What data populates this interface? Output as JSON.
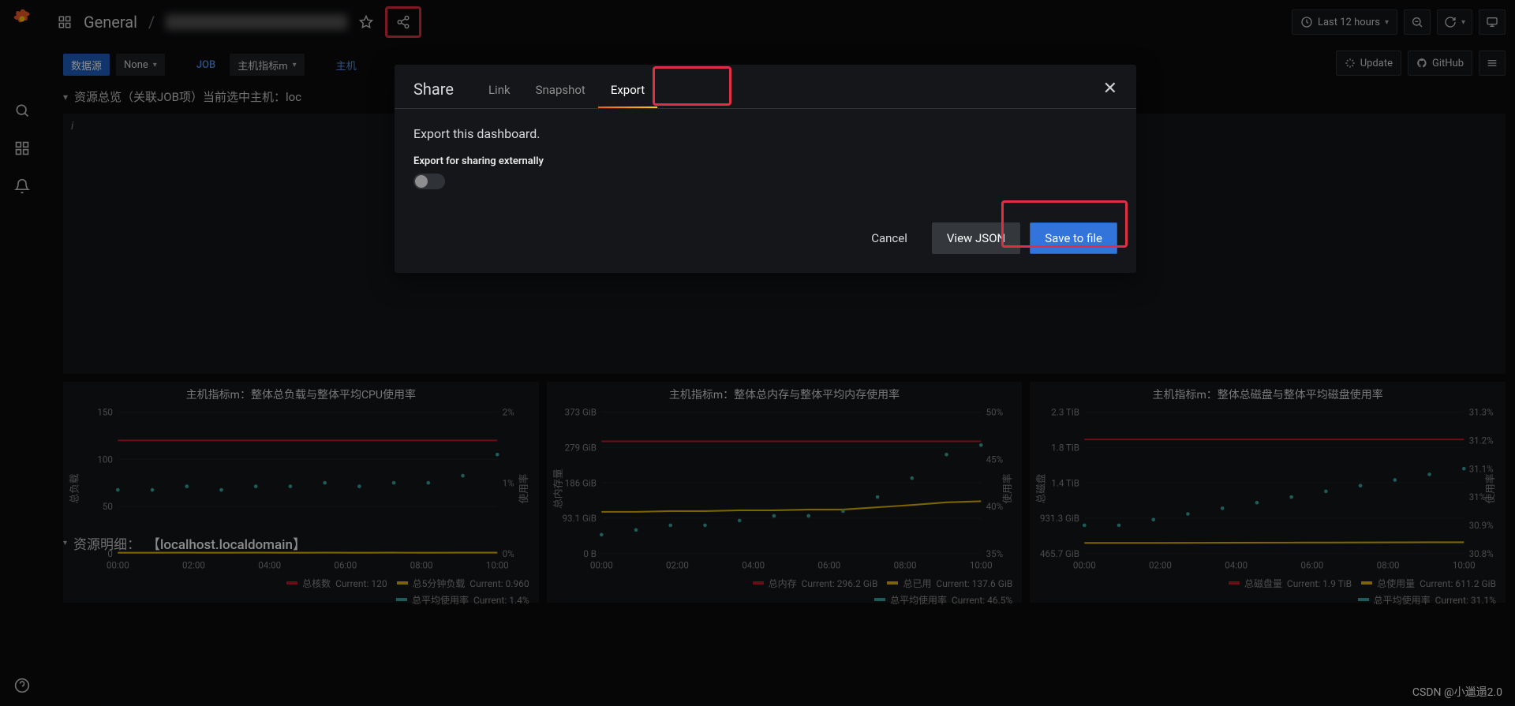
{
  "header": {
    "folder": "General",
    "star_tooltip": "Mark as favorite",
    "share_tooltip": "Share dashboard",
    "time_range": "Last 12 hours"
  },
  "toolbar": {
    "datasource_label": "数据源",
    "datasource_value": "None",
    "job_label": "JOB",
    "host_metric_label": "主机指标m",
    "extra_label": "主机",
    "update_label": "Update",
    "github_label": "GitHub"
  },
  "row1": {
    "title": "资源总览（关联JOB项）当前选中主机：loc",
    "info_icon": "i"
  },
  "modal": {
    "title": "Share",
    "tab_link": "Link",
    "tab_snapshot": "Snapshot",
    "tab_export": "Export",
    "description": "Export this dashboard.",
    "switch_label": "Export for sharing externally",
    "cancel": "Cancel",
    "view_json": "View JSON",
    "save": "Save to file"
  },
  "row2": {
    "prefix": "资源明细：",
    "host": "【localhost.localdomain】"
  },
  "watermark": "CSDN @小邋遢2.0",
  "panels": [
    {
      "title": "主机指标m：整体总负载与整体平均CPU使用率",
      "legendTop": [
        {
          "color": "#c4162a",
          "label": "总核数",
          "stat": "Current: 120"
        },
        {
          "color": "#e0b400",
          "label": "总5分钟负载",
          "stat": "Current: 0.960"
        }
      ],
      "legendBottom": [
        {
          "color": "#37a6a3",
          "label": "总平均使用率",
          "stat": "Current: 1.4%"
        }
      ]
    },
    {
      "title": "主机指标m：整体总内存与整体平均内存使用率",
      "legendTop": [
        {
          "color": "#c4162a",
          "label": "总内存",
          "stat": "Current: 296.2 GiB"
        },
        {
          "color": "#e0b400",
          "label": "总已用",
          "stat": "Current: 137.6 GiB"
        }
      ],
      "legendBottom": [
        {
          "color": "#37a6a3",
          "label": "总平均使用率",
          "stat": "Current: 46.5%"
        }
      ]
    },
    {
      "title": "主机指标m：整体总磁盘与整体平均磁盘使用率",
      "legendTop": [
        {
          "color": "#c4162a",
          "label": "总磁盘量",
          "stat": "Current: 1.9 TiB"
        },
        {
          "color": "#e0b400",
          "label": "总使用量",
          "stat": "Current: 611.2 GiB"
        }
      ],
      "legendBottom": [
        {
          "color": "#37a6a3",
          "label": "总平均使用率",
          "stat": "Current: 31.1%"
        }
      ]
    }
  ],
  "chart_data": [
    {
      "type": "line",
      "title": "主机指标m：整体总负载与整体平均CPU使用率",
      "x_ticks": [
        "00:00",
        "02:00",
        "04:00",
        "06:00",
        "08:00",
        "10:00"
      ],
      "left_axis": {
        "label": "总负载",
        "ticks": [
          0,
          50,
          100,
          150
        ],
        "range": [
          0,
          150
        ]
      },
      "right_axis": {
        "label": "使用率",
        "ticks": [
          "0%",
          "1%",
          "2%"
        ],
        "range": [
          0,
          2
        ]
      },
      "series": [
        {
          "name": "总核数",
          "axis": "left",
          "color": "#c4162a",
          "values": [
            120,
            120,
            120,
            120,
            120,
            120,
            120,
            120,
            120,
            120,
            120,
            120
          ]
        },
        {
          "name": "总5分钟负载",
          "axis": "left",
          "color": "#e0b400",
          "values": [
            0.9,
            0.9,
            0.95,
            0.9,
            0.95,
            0.9,
            0.95,
            0.9,
            0.95,
            0.9,
            0.95,
            0.96
          ]
        },
        {
          "name": "总平均使用率",
          "axis": "right",
          "color": "#37a6a3",
          "style": "dots",
          "values": [
            0.9,
            0.9,
            0.95,
            0.9,
            0.95,
            0.95,
            1.0,
            0.95,
            1.0,
            1.0,
            1.1,
            1.4
          ]
        }
      ]
    },
    {
      "type": "line",
      "title": "主机指标m：整体总内存与整体平均内存使用率",
      "x_ticks": [
        "00:00",
        "02:00",
        "04:00",
        "06:00",
        "08:00",
        "10:00"
      ],
      "left_axis": {
        "label": "总内存量",
        "ticks": [
          "0 B",
          "93.1 GiB",
          "186 GiB",
          "279 GiB",
          "373 GiB"
        ],
        "range": [
          0,
          373
        ]
      },
      "right_axis": {
        "label": "使用率",
        "ticks": [
          "35%",
          "40%",
          "45%",
          "50%"
        ],
        "range": [
          35,
          50
        ]
      },
      "series": [
        {
          "name": "总内存",
          "axis": "left",
          "color": "#c4162a",
          "values": [
            296,
            296,
            296,
            296,
            296,
            296,
            296,
            296,
            296,
            296,
            296,
            296
          ]
        },
        {
          "name": "总已用",
          "axis": "left",
          "color": "#e0b400",
          "values": [
            110,
            110,
            112,
            112,
            114,
            114,
            116,
            116,
            122,
            128,
            135,
            138
          ]
        },
        {
          "name": "总平均使用率",
          "axis": "right",
          "color": "#37a6a3",
          "style": "dots",
          "values": [
            37,
            37.5,
            38,
            38,
            38.5,
            39,
            39,
            39.5,
            41,
            43,
            45.5,
            46.5
          ]
        }
      ]
    },
    {
      "type": "line",
      "title": "主机指标m：整体总磁盘与整体平均磁盘使用率",
      "x_ticks": [
        "00:00",
        "02:00",
        "04:00",
        "06:00",
        "08:00",
        "10:00"
      ],
      "left_axis": {
        "label": "总磁盘",
        "ticks": [
          "465.7 GiB",
          "931.3 GiB",
          "1.4 TiB",
          "1.8 TiB",
          "2.3 TiB"
        ],
        "range": [
          465,
          2300
        ]
      },
      "right_axis": {
        "label": "使用率",
        "ticks": [
          "30.8%",
          "30.9%",
          "31%",
          "31.1%",
          "31.2%",
          "31.3%"
        ],
        "range": [
          30.8,
          31.3
        ]
      },
      "series": [
        {
          "name": "总磁盘量",
          "axis": "left",
          "color": "#c4162a",
          "values": [
            1946,
            1946,
            1946,
            1946,
            1946,
            1946,
            1946,
            1946,
            1946,
            1946,
            1946,
            1946
          ]
        },
        {
          "name": "总使用量",
          "axis": "left",
          "color": "#e0b400",
          "values": [
            602,
            602,
            603,
            604,
            605,
            606,
            607,
            608,
            609,
            610,
            611,
            611
          ]
        },
        {
          "name": "总平均使用率",
          "axis": "right",
          "color": "#37a6a3",
          "style": "dots",
          "values": [
            30.9,
            30.9,
            30.92,
            30.94,
            30.96,
            30.98,
            31.0,
            31.02,
            31.04,
            31.06,
            31.08,
            31.1
          ]
        }
      ]
    }
  ]
}
